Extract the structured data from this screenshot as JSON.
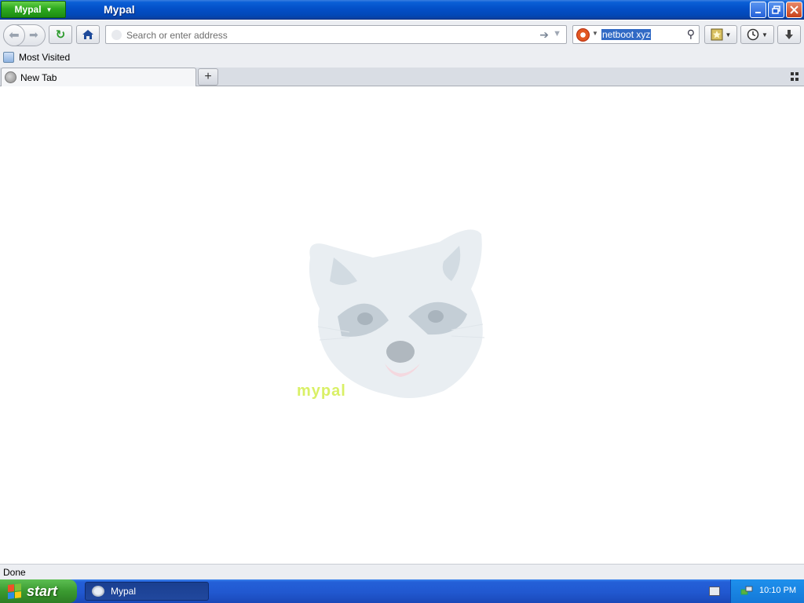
{
  "window": {
    "app_menu_label": "Mypal",
    "title": "Mypal"
  },
  "navbar": {
    "url_placeholder": "Search or enter address",
    "search_text": "netboot xyz"
  },
  "bookmarks_bar": {
    "items": [
      {
        "label": "Most Visited"
      }
    ]
  },
  "tabs": [
    {
      "label": "New Tab",
      "active": true
    }
  ],
  "content": {
    "logo_text": "mypal"
  },
  "status": {
    "text": "Done"
  },
  "taskbar": {
    "start_label": "start",
    "items": [
      {
        "label": "Mypal"
      }
    ],
    "clock": "10:10 PM"
  },
  "colors": {
    "titlebar": "#0350c8",
    "app_menu": "#2eaa1f",
    "selection": "#316ac5",
    "taskbar": "#2158d0",
    "start": "#3a9a30"
  }
}
